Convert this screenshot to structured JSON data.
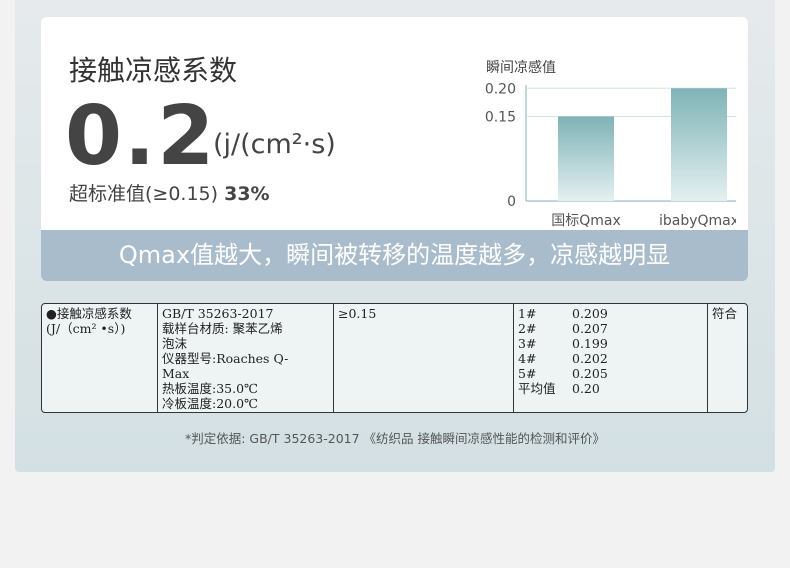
{
  "header": {
    "title": "接触凉感系数",
    "value": "0.2",
    "unit": "(j/(cm²·s)",
    "exceed_label": "超标准值(≥0.15)",
    "exceed_value": "33%"
  },
  "chart_data": {
    "type": "bar",
    "title": "瞬间凉感值",
    "categories": [
      "国标Qmax",
      "ibabyQmax"
    ],
    "values": [
      0.15,
      0.2
    ],
    "yticks": [
      "0",
      "0.15",
      "0.20"
    ],
    "ylim": [
      0,
      0.22
    ],
    "colors": [
      "#7fb3b6",
      "#7fb3b6"
    ]
  },
  "banner": "Qmax值越大，瞬间被转移的温度越多，凉感越明显",
  "table": {
    "item": [
      "●接触凉感系数",
      "(J/（cm² •s）)"
    ],
    "method": [
      "GB/T 35263-2017",
      "载样台材质: 聚苯乙烯",
      "泡沫",
      "仪器型号:Roaches Q-",
      "Max",
      "热板温度:35.0℃",
      "冷板温度:20.0℃"
    ],
    "standard": "≥0.15",
    "results": [
      [
        "1#",
        "0.209"
      ],
      [
        "2#",
        "0.207"
      ],
      [
        "3#",
        "0.199"
      ],
      [
        "4#",
        "0.202"
      ],
      [
        "5#",
        "0.205"
      ],
      [
        "平均值",
        "0.20"
      ]
    ],
    "verdict": "符合"
  },
  "basis": "*判定依据: GB/T 35263-2017 《纺织品 接触瞬间凉感性能的检测和评价》"
}
